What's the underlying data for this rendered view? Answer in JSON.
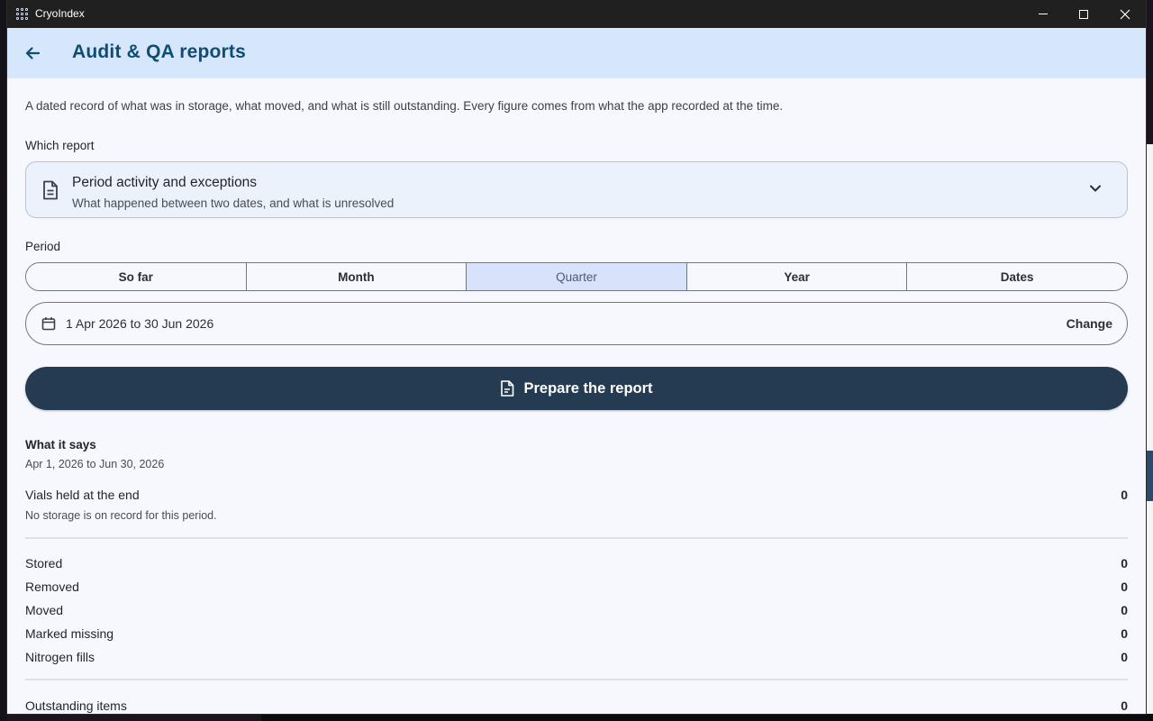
{
  "window": {
    "app_title": "CryoIndex"
  },
  "header": {
    "title": "Audit & QA reports"
  },
  "intro": "A dated record of what was in storage, what moved, and what is still outstanding. Every figure comes from what the app recorded at the time.",
  "report_picker": {
    "label": "Which report",
    "selected_title": "Period activity and exceptions",
    "selected_subtitle": "What happened between two dates, and what is unresolved",
    "icon": "document-icon"
  },
  "period": {
    "label": "Period",
    "options": [
      "So far",
      "Month",
      "Quarter",
      "Year",
      "Dates"
    ],
    "selected": "Quarter",
    "range_text": "1 Apr 2026 to 30 Jun 2026",
    "change_label": "Change"
  },
  "prepare": {
    "label": "Prepare the report"
  },
  "summary": {
    "title": "What it says",
    "range": "Apr 1, 2026 to Jun 30, 2026",
    "held": {
      "label": "Vials held at the end",
      "value": "0",
      "note": "No storage is on record for this period."
    },
    "activity": [
      {
        "label": "Stored",
        "value": "0"
      },
      {
        "label": "Removed",
        "value": "0"
      },
      {
        "label": "Moved",
        "value": "0"
      },
      {
        "label": "Marked missing",
        "value": "0"
      },
      {
        "label": "Nitrogen fills",
        "value": "0"
      }
    ],
    "outstanding": {
      "label": "Outstanding items",
      "value": "0"
    }
  },
  "colors": {
    "appbar": "#d6e6fb",
    "title": "#0f4d73",
    "primary_button": "#253b51",
    "segment_active": "#d8e3fb"
  }
}
